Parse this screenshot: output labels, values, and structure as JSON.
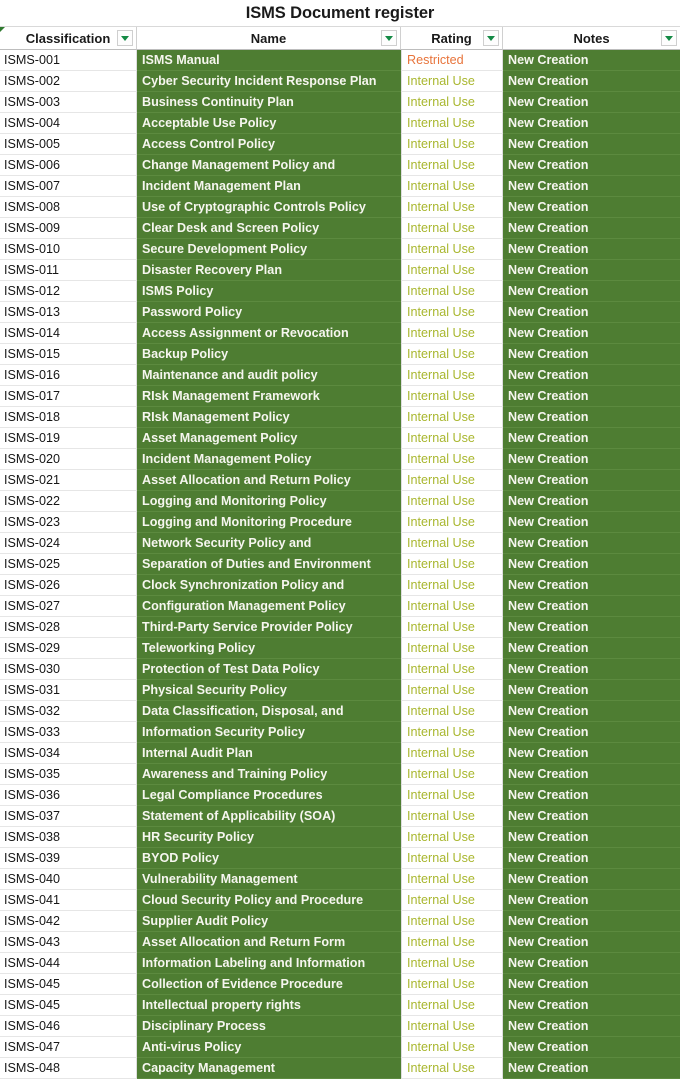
{
  "title": "ISMS Document register",
  "columns": [
    {
      "key": "classification",
      "label": "Classification",
      "has_filter": true
    },
    {
      "key": "name",
      "label": "Name",
      "has_filter": true
    },
    {
      "key": "rating",
      "label": "Rating",
      "has_filter": true
    },
    {
      "key": "notes",
      "label": "Notes",
      "has_filter": true
    }
  ],
  "colors": {
    "green_fill": "#4E7D32",
    "name_text": "#F6F6EF",
    "restricted": "#E8743B",
    "internal_use": "#A9B72F",
    "filter_arrow": "#148A45"
  },
  "icons": {
    "filter": "filter-dropdown-icon",
    "comment_marker": "cell-comment-marker-icon"
  },
  "rows": [
    {
      "classification": "ISMS-001",
      "name": "ISMS Manual",
      "rating": "Restricted",
      "notes": "New Creation"
    },
    {
      "classification": "ISMS-002",
      "name": "Cyber Security Incident Response Plan",
      "rating": "Internal Use",
      "notes": "New Creation"
    },
    {
      "classification": "ISMS-003",
      "name": "Business Continuity Plan",
      "rating": "Internal Use",
      "notes": "New Creation"
    },
    {
      "classification": "ISMS-004",
      "name": "Acceptable Use Policy",
      "rating": "Internal Use",
      "notes": "New Creation"
    },
    {
      "classification": "ISMS-005",
      "name": "Access Control Policy",
      "rating": "Internal Use",
      "notes": "New Creation"
    },
    {
      "classification": "ISMS-006",
      "name": "Change Management Policy and",
      "rating": "Internal Use",
      "notes": "New Creation"
    },
    {
      "classification": "ISMS-007",
      "name": "Incident Management Plan",
      "rating": "Internal Use",
      "notes": "New Creation"
    },
    {
      "classification": "ISMS-008",
      "name": "Use of Cryptographic Controls Policy",
      "rating": "Internal Use",
      "notes": "New Creation"
    },
    {
      "classification": "ISMS-009",
      "name": "Clear Desk and Screen Policy",
      "rating": "Internal Use",
      "notes": "New Creation"
    },
    {
      "classification": "ISMS-010",
      "name": "Secure Development Policy",
      "rating": "Internal Use",
      "notes": "New Creation"
    },
    {
      "classification": "ISMS-011",
      "name": "Disaster Recovery Plan",
      "rating": "Internal Use",
      "notes": "New Creation"
    },
    {
      "classification": "ISMS-012",
      "name": "ISMS Policy",
      "rating": "Internal Use",
      "notes": "New Creation"
    },
    {
      "classification": "ISMS-013",
      "name": "Password Policy",
      "rating": "Internal Use",
      "notes": "New Creation"
    },
    {
      "classification": "ISMS-014",
      "name": "Access Assignment or Revocation",
      "rating": "Internal Use",
      "notes": "New Creation"
    },
    {
      "classification": "ISMS-015",
      "name": "Backup Policy",
      "rating": "Internal Use",
      "notes": "New Creation"
    },
    {
      "classification": "ISMS-016",
      "name": "Maintenance and audit policy",
      "rating": "Internal Use",
      "notes": "New Creation"
    },
    {
      "classification": "ISMS-017",
      "name": "RIsk Management Framework",
      "rating": "Internal Use",
      "notes": "New Creation"
    },
    {
      "classification": "ISMS-018",
      "name": "RIsk Management Policy",
      "rating": "Internal Use",
      "notes": "New Creation"
    },
    {
      "classification": "ISMS-019",
      "name": "Asset Management Policy",
      "rating": "Internal Use",
      "notes": "New Creation"
    },
    {
      "classification": "ISMS-020",
      "name": "Incident Management Policy",
      "rating": "Internal Use",
      "notes": "New Creation"
    },
    {
      "classification": "ISMS-021",
      "name": "Asset Allocation and Return Policy",
      "rating": "Internal Use",
      "notes": "New Creation"
    },
    {
      "classification": "ISMS-022",
      "name": "Logging and Monitoring Policy",
      "rating": "Internal Use",
      "notes": "New Creation"
    },
    {
      "classification": "ISMS-023",
      "name": "Logging and Monitoring Procedure",
      "rating": "Internal Use",
      "notes": "New Creation"
    },
    {
      "classification": "ISMS-024",
      "name": "Network Security Policy and",
      "rating": "Internal Use",
      "notes": "New Creation"
    },
    {
      "classification": "ISMS-025",
      "name": "Separation of Duties and Environment",
      "rating": "Internal Use",
      "notes": "New Creation"
    },
    {
      "classification": "ISMS-026",
      "name": "Clock Synchronization Policy and",
      "rating": "Internal Use",
      "notes": "New Creation"
    },
    {
      "classification": "ISMS-027",
      "name": "Configuration Management Policy",
      "rating": "Internal Use",
      "notes": "New Creation"
    },
    {
      "classification": "ISMS-028",
      "name": "Third-Party Service Provider Policy",
      "rating": "Internal Use",
      "notes": "New Creation"
    },
    {
      "classification": "ISMS-029",
      "name": "Teleworking Policy",
      "rating": "Internal Use",
      "notes": "New Creation"
    },
    {
      "classification": "ISMS-030",
      "name": "Protection of Test Data Policy",
      "rating": "Internal Use",
      "notes": "New Creation"
    },
    {
      "classification": "ISMS-031",
      "name": "Physical Security Policy",
      "rating": "Internal Use",
      "notes": "New Creation"
    },
    {
      "classification": "ISMS-032",
      "name": "Data Classification, Disposal, and",
      "rating": "Internal Use",
      "notes": "New Creation"
    },
    {
      "classification": "ISMS-033",
      "name": "Information Security Policy",
      "rating": "Internal Use",
      "notes": "New Creation"
    },
    {
      "classification": "ISMS-034",
      "name": " Internal Audit Plan",
      "rating": "Internal Use",
      "notes": "New Creation"
    },
    {
      "classification": "ISMS-035",
      "name": "Awareness and Training Policy",
      "rating": "Internal Use",
      "notes": "New Creation"
    },
    {
      "classification": "ISMS-036",
      "name": "Legal Compliance Procedures",
      "rating": "Internal Use",
      "notes": "New Creation"
    },
    {
      "classification": "ISMS-037",
      "name": "Statement of Applicability (SOA)",
      "rating": "Internal Use",
      "notes": "New Creation"
    },
    {
      "classification": "ISMS-038",
      "name": "HR Security Policy",
      "rating": "Internal Use",
      "notes": "New Creation"
    },
    {
      "classification": "ISMS-039",
      "name": "BYOD Policy",
      "rating": "Internal Use",
      "notes": "New Creation"
    },
    {
      "classification": "ISMS-040",
      "name": "Vulnerability Management",
      "rating": "Internal Use",
      "notes": "New Creation"
    },
    {
      "classification": "ISMS-041",
      "name": "Cloud Security Policy and Procedure",
      "rating": "Internal Use",
      "notes": "New Creation"
    },
    {
      "classification": "ISMS-042",
      "name": "Supplier Audit Policy",
      "rating": "Internal Use",
      "notes": "New Creation"
    },
    {
      "classification": "ISMS-043",
      "name": "Asset Allocation and Return Form",
      "rating": "Internal Use",
      "notes": "New Creation"
    },
    {
      "classification": "ISMS-044",
      "name": "Information Labeling and Information",
      "rating": "Internal Use",
      "notes": "New Creation"
    },
    {
      "classification": "ISMS-045",
      "name": "Collection of Evidence Procedure",
      "rating": "Internal Use",
      "notes": "New Creation"
    },
    {
      "classification": "ISMS-045",
      "name": "Intellectual property rights",
      "rating": "Internal Use",
      "notes": "New Creation"
    },
    {
      "classification": "ISMS-046",
      "name": "Disciplinary Process",
      "rating": "Internal Use",
      "notes": "New Creation"
    },
    {
      "classification": "ISMS-047",
      "name": " Anti-virus Policy",
      "rating": "Internal Use",
      "notes": "New Creation"
    },
    {
      "classification": "ISMS-048",
      "name": " Capacity Management",
      "rating": "Internal Use",
      "notes": "New Creation"
    }
  ]
}
